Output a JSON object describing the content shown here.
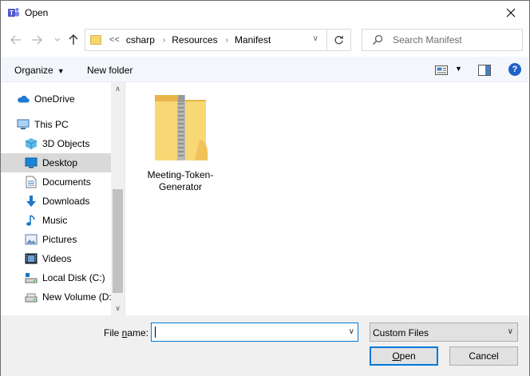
{
  "window": {
    "title": "Open"
  },
  "address": {
    "more": "<<",
    "crumbs": [
      "csharp",
      "Resources",
      "Manifest"
    ]
  },
  "search": {
    "placeholder": "Search Manifest"
  },
  "toolbar": {
    "organize": "Organize",
    "new_folder": "New folder",
    "help": "?"
  },
  "sidebar": {
    "items": [
      {
        "label": "OneDrive",
        "icon": "onedrive-icon"
      },
      {
        "label": "This PC",
        "icon": "computer-icon"
      },
      {
        "label": "3D Objects",
        "icon": "cube-icon"
      },
      {
        "label": "Desktop",
        "icon": "desktop-icon",
        "selected": true
      },
      {
        "label": "Documents",
        "icon": "document-icon"
      },
      {
        "label": "Downloads",
        "icon": "download-icon"
      },
      {
        "label": "Music",
        "icon": "music-icon"
      },
      {
        "label": "Pictures",
        "icon": "picture-icon"
      },
      {
        "label": "Videos",
        "icon": "video-icon"
      },
      {
        "label": "Local Disk (C:)",
        "icon": "drive-icon"
      },
      {
        "label": "New Volume (D:",
        "icon": "drive-icon"
      }
    ]
  },
  "files": [
    {
      "name_line1": "Meeting-Token-",
      "name_line2": "Generator",
      "icon": "zip-folder-icon"
    }
  ],
  "bottom": {
    "file_name_label_pre": "File ",
    "file_name_label_ul": "n",
    "file_name_label_post": "ame:",
    "file_name_value": "",
    "filter": "Custom Files",
    "open_ul": "O",
    "open_rest": "pen",
    "cancel": "Cancel"
  },
  "colors": {
    "accent": "#0078d7",
    "selected": "#d9d9d9",
    "toolbar_bg": "#f3f6fb",
    "footer_bg": "#f0f0f0"
  }
}
